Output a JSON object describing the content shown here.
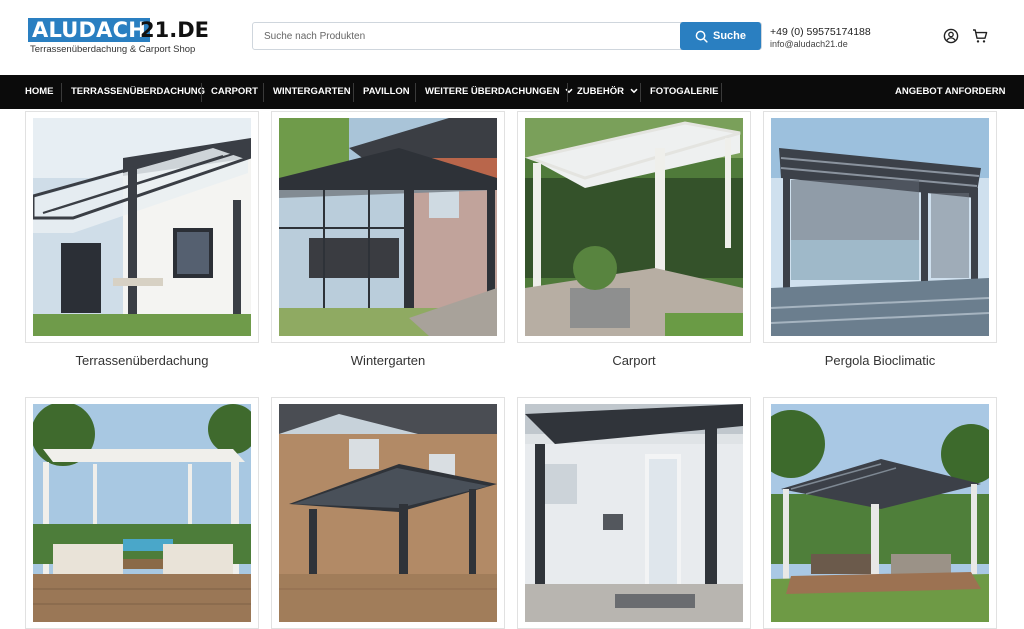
{
  "header": {
    "logo_main": "ALUDACH",
    "logo_tld": "21.DE",
    "logo_tagline": "Terrassenüberdachung & Carport Shop",
    "search_placeholder": "Suche nach Produkten",
    "search_button": "Suche",
    "phone": "+49 (0) 59575174188",
    "email": "info@aludach21.de",
    "brand_color": "#2a7fc1"
  },
  "nav": {
    "items": [
      {
        "label": "HOME"
      },
      {
        "label": "TERRASSENÜBERDACHUNG"
      },
      {
        "label": "CARPORT"
      },
      {
        "label": "WINTERGARTEN"
      },
      {
        "label": "PAVILLON"
      },
      {
        "label": "WEITERE ÜBERDACHUNGEN"
      },
      {
        "label": "ZUBEHÖR"
      },
      {
        "label": "FOTOGALERIE"
      }
    ],
    "cta": "ANGEBOT ANFORDERN"
  },
  "categories": [
    {
      "label": "Terrassenüberdachung"
    },
    {
      "label": "Wintergarten"
    },
    {
      "label": "Carport"
    },
    {
      "label": "Pergola Bioclimatic"
    },
    {
      "label": ""
    },
    {
      "label": ""
    },
    {
      "label": ""
    },
    {
      "label": ""
    }
  ]
}
